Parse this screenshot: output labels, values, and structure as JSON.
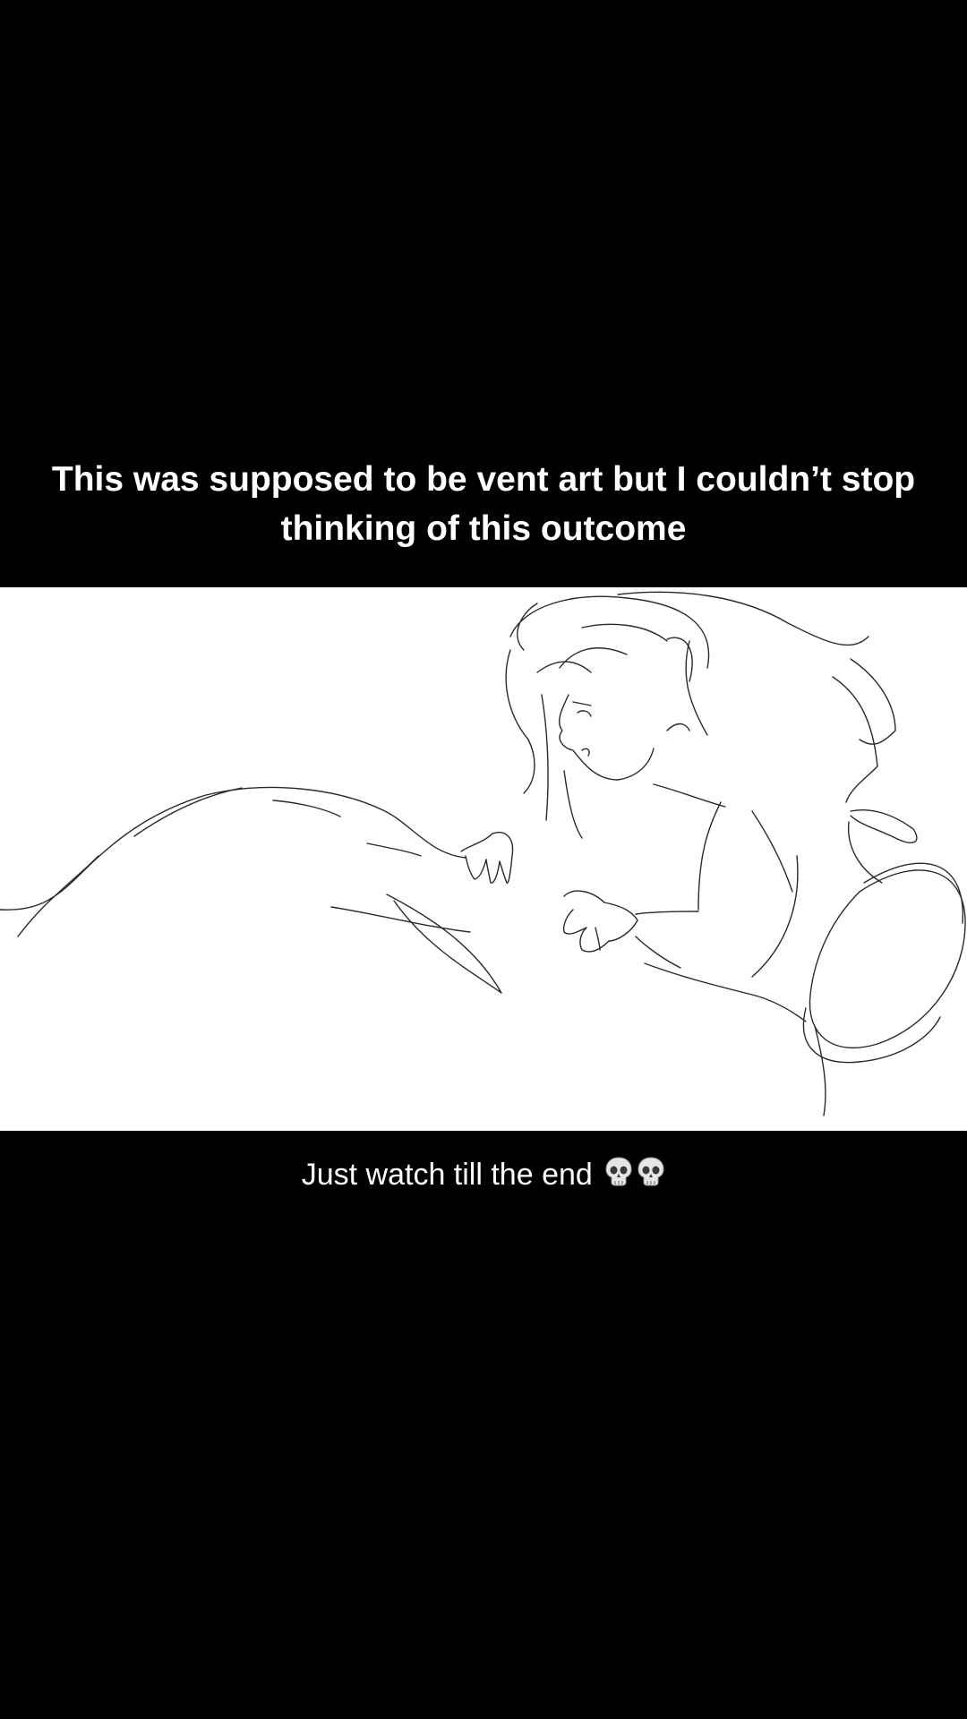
{
  "captions": {
    "top": "This was supposed to be vent art but I couldn’t stop thinking of this outcome",
    "bottom": "Just watch till the end"
  },
  "icons": {
    "emoji": [
      "skull-icon",
      "skull-icon"
    ]
  },
  "colors": {
    "background": "#000000",
    "text": "#ffffff",
    "panel": "#ffffff",
    "sketch_line": "#2a2a2a"
  }
}
